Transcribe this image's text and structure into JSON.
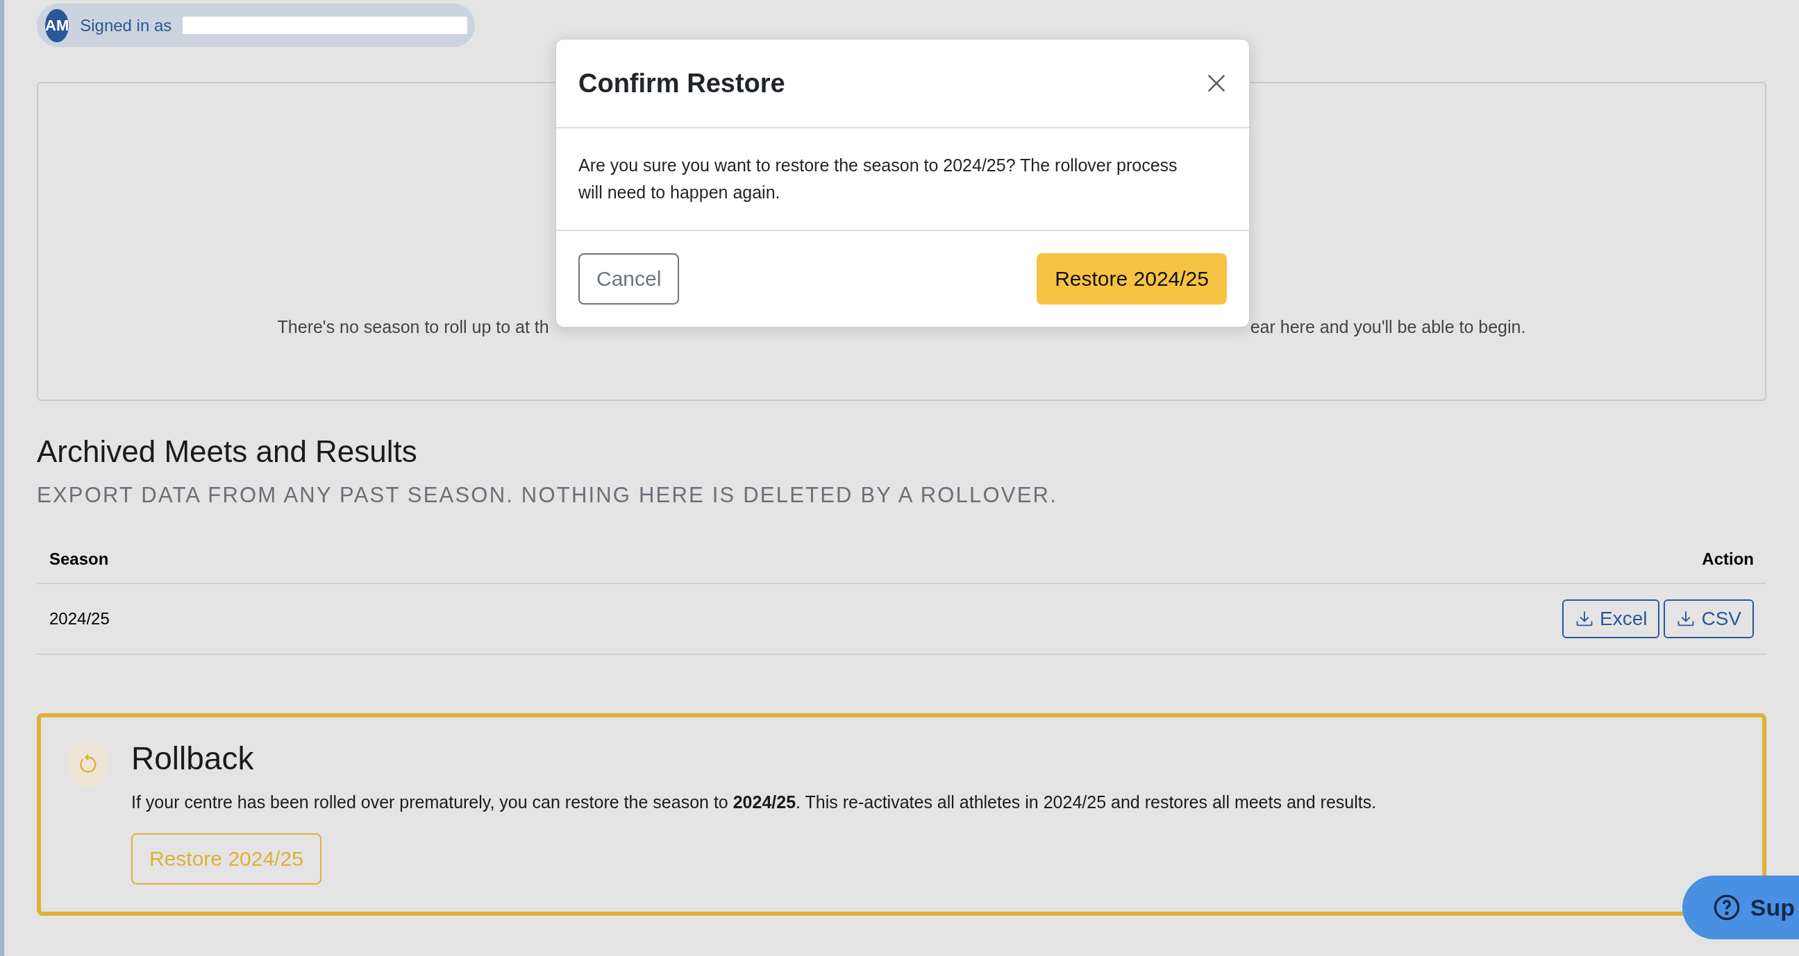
{
  "user_badge": {
    "initials": "AM",
    "label": "Signed in as"
  },
  "empty_state": {
    "text_before": "There's no season to roll up to at th",
    "text_after": "ear here and you'll be able to begin."
  },
  "archive": {
    "title": "Archived Meets and Results",
    "subtitle": "EXPORT DATA FROM ANY PAST SEASON. NOTHING HERE IS DELETED BY A ROLLOVER.",
    "columns": [
      "Season",
      "Action"
    ],
    "rows": [
      {
        "season": "2024/25",
        "actions": [
          "Excel",
          "CSV"
        ]
      }
    ]
  },
  "rollback": {
    "title": "Rollback",
    "text": "If your centre has been rolled over prematurely, you can restore the season to **2024/25**. This re-activates all athletes in 2024/25 and restores all meets and results.",
    "button": "Restore 2024/25"
  },
  "modal": {
    "title": "Confirm Restore",
    "body": "Are you sure you want to restore the season to 2024/25? The rollover process will need to happen again.",
    "buttons": [
      {
        "label": "Cancel",
        "kind": "secondary"
      },
      {
        "label": "Restore 2024/25",
        "kind": "primary"
      }
    ]
  },
  "support_button": {
    "label": "Sup"
  }
}
